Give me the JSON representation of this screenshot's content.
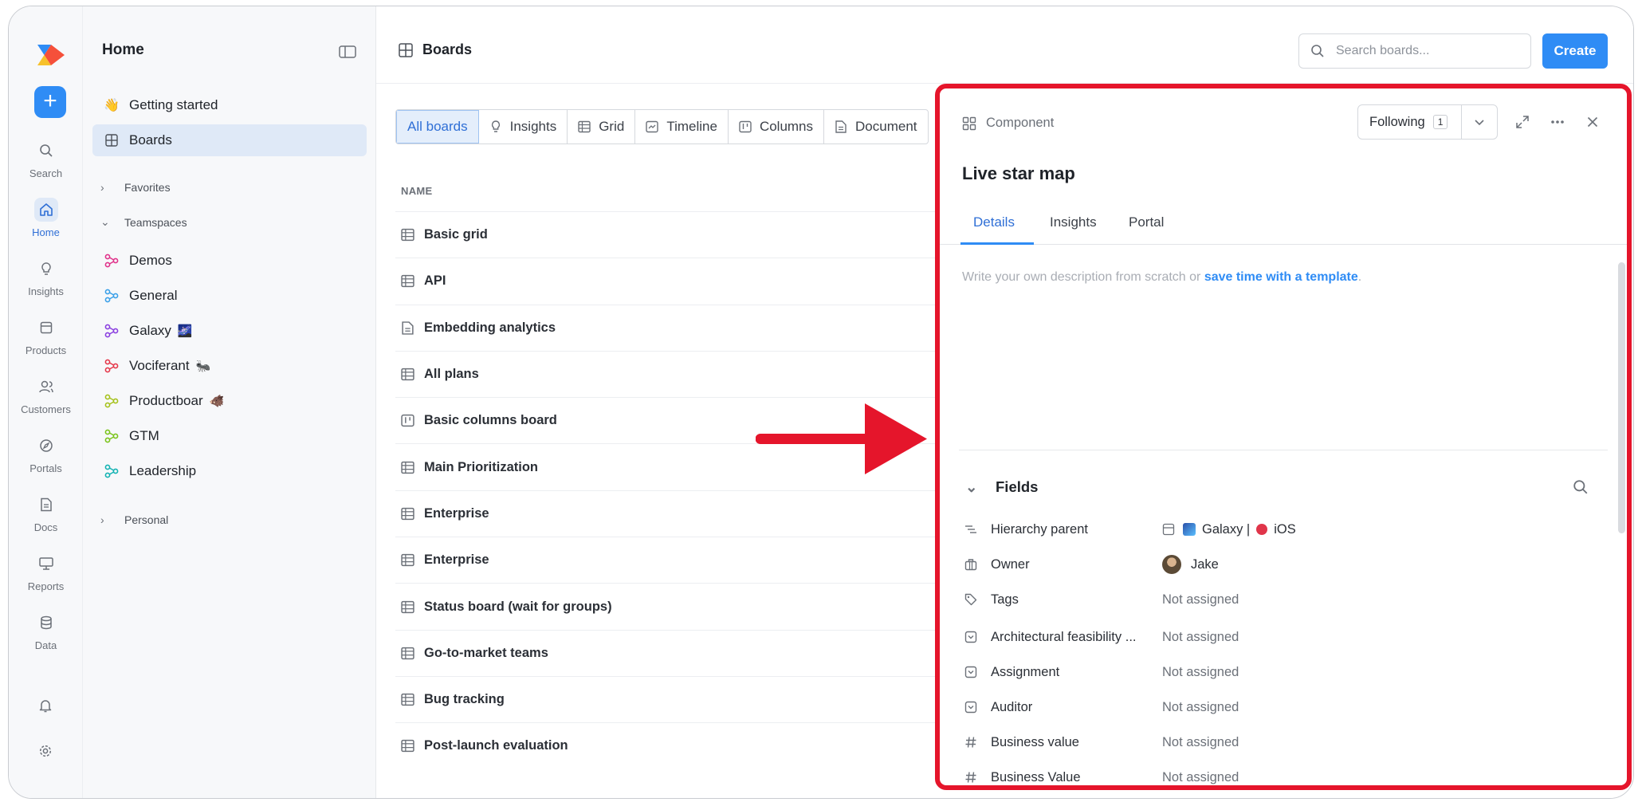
{
  "rail": {
    "items": [
      {
        "label": "Search",
        "icon": "search-icon"
      },
      {
        "label": "Home",
        "icon": "home-icon"
      },
      {
        "label": "Insights",
        "icon": "lightbulb-icon"
      },
      {
        "label": "Products",
        "icon": "box-icon"
      },
      {
        "label": "Customers",
        "icon": "users-icon"
      },
      {
        "label": "Portals",
        "icon": "compass-icon"
      },
      {
        "label": "Docs",
        "icon": "doc-icon"
      },
      {
        "label": "Reports",
        "icon": "presentation-icon"
      },
      {
        "label": "Data",
        "icon": "database-icon"
      }
    ],
    "create_label": "+"
  },
  "sidebar": {
    "title": "Home",
    "items": [
      {
        "label": "Getting started",
        "icon": "wave-icon"
      },
      {
        "label": "Boards",
        "icon": "grid-icon"
      }
    ],
    "sections": {
      "favorites": "Favorites",
      "teamspaces": "Teamspaces",
      "personal": "Personal"
    },
    "teamspaces": [
      {
        "label": "Demos",
        "color": "#e0328a",
        "emoji": ""
      },
      {
        "label": "General",
        "color": "#3aa0e8",
        "emoji": ""
      },
      {
        "label": "Galaxy",
        "color": "#8a3fe0",
        "emoji": "🌌"
      },
      {
        "label": "Vociferant",
        "color": "#e5384a",
        "emoji": "🐜"
      },
      {
        "label": "Productboar",
        "color": "#a6c21c",
        "emoji": "🐗"
      },
      {
        "label": "GTM",
        "color": "#7bc41c",
        "emoji": ""
      },
      {
        "label": "Leadership",
        "color": "#14b3b3",
        "emoji": ""
      }
    ]
  },
  "header": {
    "title": "Boards",
    "search_placeholder": "Search boards...",
    "create_label": "Create"
  },
  "tabs": [
    {
      "label": "All boards",
      "icon": ""
    },
    {
      "label": "Insights",
      "icon": "lightbulb-icon"
    },
    {
      "label": "Grid",
      "icon": "table-icon"
    },
    {
      "label": "Timeline",
      "icon": "timeline-icon"
    },
    {
      "label": "Columns",
      "icon": "columns-icon"
    },
    {
      "label": "Document",
      "icon": "doc-icon"
    }
  ],
  "table": {
    "column_name": "NAME",
    "rows": [
      {
        "name": "Basic grid",
        "icon": "table-icon"
      },
      {
        "name": "API",
        "icon": "table-icon"
      },
      {
        "name": "Embedding analytics",
        "icon": "doc-icon"
      },
      {
        "name": "All plans",
        "icon": "table-icon"
      },
      {
        "name": "Basic columns board",
        "icon": "columns-icon"
      },
      {
        "name": "Main Prioritization",
        "icon": "table-icon"
      },
      {
        "name": "Enterprise",
        "icon": "table-icon"
      },
      {
        "name": "Enterprise",
        "icon": "table-icon"
      },
      {
        "name": "Status board (wait for groups)",
        "icon": "table-icon"
      },
      {
        "name": "Go-to-market teams",
        "icon": "table-icon"
      },
      {
        "name": "Bug tracking",
        "icon": "table-icon"
      },
      {
        "name": "Post-launch evaluation",
        "icon": "table-icon"
      }
    ]
  },
  "drawer": {
    "type_label": "Component",
    "following_label": "Following",
    "following_count": "1",
    "title": "Live star map",
    "tabs": [
      "Details",
      "Insights",
      "Portal"
    ],
    "description_prefix": "Write your own description from scratch or ",
    "description_link": "save time with a template",
    "description_suffix": ".",
    "fields_heading": "Fields",
    "fields": [
      {
        "name": "Hierarchy parent",
        "value": "Galaxy | ",
        "value2": "iOS",
        "icon": "hierarchy-icon"
      },
      {
        "name": "Owner",
        "value": "Jake",
        "icon": "briefcase-icon"
      },
      {
        "name": "Tags",
        "value": "Not assigned",
        "icon": "tag-icon"
      },
      {
        "name": "Architectural feasibility ...",
        "value": "Not assigned",
        "icon": "dropdown-field-icon"
      },
      {
        "name": "Assignment",
        "value": "Not assigned",
        "icon": "dropdown-field-icon"
      },
      {
        "name": "Auditor",
        "value": "Not assigned",
        "icon": "dropdown-field-icon"
      },
      {
        "name": "Business value",
        "value": "Not assigned",
        "icon": "hash-icon"
      },
      {
        "name": "Business Value",
        "value": "Not assigned",
        "icon": "hash-icon"
      }
    ]
  },
  "colors": {
    "accent": "#2f8cf5",
    "highlight_border": "#e5152b",
    "arrow": "#e5152b"
  }
}
